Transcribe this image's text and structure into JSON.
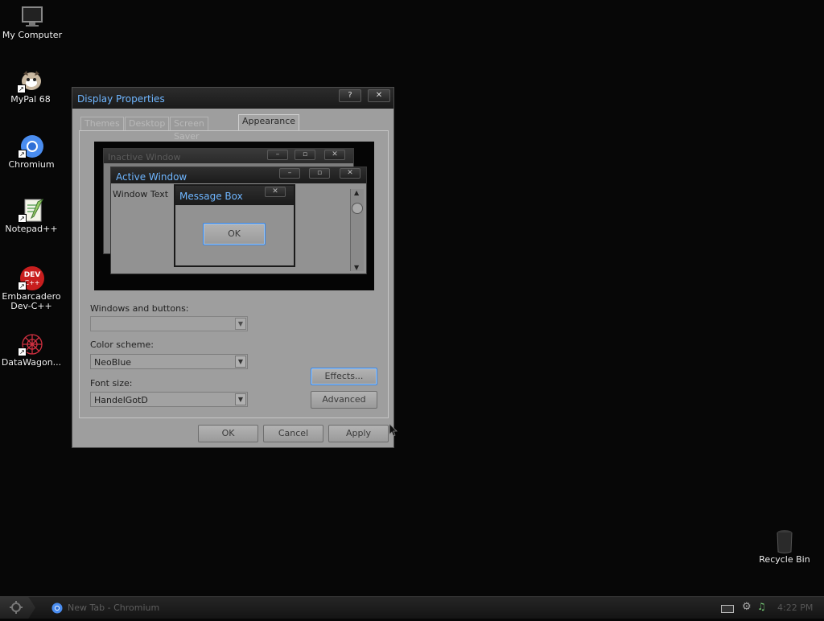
{
  "desktop": {
    "icons": [
      {
        "label": "My Computer"
      },
      {
        "label": "MyPal 68"
      },
      {
        "label": "Chromium"
      },
      {
        "label": "Notepad++"
      },
      {
        "label": "Embarcadero Dev-C++"
      },
      {
        "label": "DataWagon..."
      },
      {
        "label": "Recycle Bin"
      }
    ]
  },
  "dialog": {
    "title": "Display Properties",
    "help_glyph": "?",
    "close_glyph": "✕",
    "tabs": [
      {
        "label": "Themes"
      },
      {
        "label": "Desktop"
      },
      {
        "label": "Screen Saver"
      },
      {
        "label": "Appearance"
      }
    ],
    "preview": {
      "inactive_title": "Inactive Window",
      "active_title": "Active Window",
      "window_text": "Window Text",
      "message_title": "Message Box",
      "ok_label": "OK"
    },
    "windows_and_buttons": {
      "label": "Windows and buttons:",
      "value": ""
    },
    "color_scheme": {
      "label": "Color scheme:",
      "value": "NeoBlue"
    },
    "font_size": {
      "label": "Font size:",
      "value": "HandelGotD"
    },
    "effects_label": "Effects...",
    "advanced_label": "Advanced",
    "ok_label": "OK",
    "cancel_label": "Cancel",
    "apply_label": "Apply"
  },
  "taskbar": {
    "task_label": "New Tab - Chromium",
    "clock": "4:22 PM"
  },
  "colors": {
    "title_text": "#6fb6ff",
    "focus_border": "#3d86e0",
    "desktop_bg": "#070707"
  }
}
